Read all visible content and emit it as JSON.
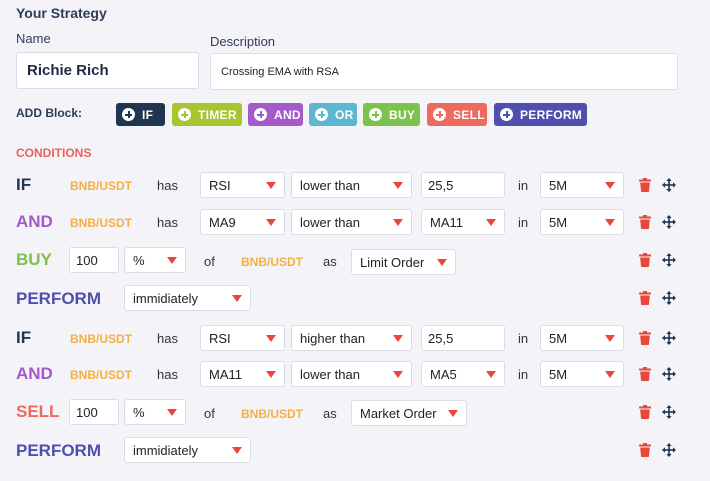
{
  "strategy": {
    "title": "Your Strategy",
    "name_label": "Name",
    "name_value": "Richie Rich",
    "description_label": "Description",
    "description_value": "Crossing EMA with RSA"
  },
  "add_block": {
    "label": "ADD Block:",
    "buttons": [
      {
        "label": "IF",
        "color": "#1f3550"
      },
      {
        "label": "TIMER",
        "color": "#a6c52f"
      },
      {
        "label": "AND",
        "color": "#a45ac8"
      },
      {
        "label": "OR",
        "color": "#5bb8d0"
      },
      {
        "label": "BUY",
        "color": "#7cc24b"
      },
      {
        "label": "SELL",
        "color": "#ee6a5e"
      },
      {
        "label": "PERFORM",
        "color": "#4f4fb0"
      }
    ]
  },
  "conditions": {
    "title": "CONDITIONS",
    "rows": [
      {
        "keyword": "IF",
        "pair": "BNB/USDT",
        "has": "has",
        "indicator": "RSI",
        "comparator": "lower than",
        "value": "25,5",
        "in": "in",
        "timeframe": "5M"
      },
      {
        "keyword": "AND",
        "pair": "BNB/USDT",
        "has": "has",
        "indicator": "MA9",
        "comparator": "lower than",
        "value": "MA11",
        "in": "in",
        "timeframe": "5M"
      },
      {
        "keyword": "BUY",
        "amount": "100",
        "unit": "%",
        "of": "of",
        "pair": "BNB/USDT",
        "as": "as",
        "order_type": "Limit Order"
      },
      {
        "keyword": "PERFORM",
        "timing": "immidiately"
      },
      {
        "keyword": "IF",
        "pair": "BNB/USDT",
        "has": "has",
        "indicator": "RSI",
        "comparator": "higher than",
        "value": "25,5",
        "in": "in",
        "timeframe": "5M"
      },
      {
        "keyword": "AND",
        "pair": "BNB/USDT",
        "has": "has",
        "indicator": "MA11",
        "comparator": "lower than",
        "value": "MA5",
        "in": "in",
        "timeframe": "5M"
      },
      {
        "keyword": "SELL",
        "amount": "100",
        "unit": "%",
        "of": "of",
        "pair": "BNB/USDT",
        "as": "as",
        "order_type": "Market Order"
      },
      {
        "keyword": "PERFORM",
        "timing": "immidiately"
      }
    ]
  },
  "colors": {
    "if": "#1f3550",
    "and": "#a45ac8",
    "buy": "#7cc24b",
    "sell": "#ee6a5e",
    "perform": "#4f4fb0",
    "pair": "#f5b043",
    "accent_red": "#e8473c",
    "move_icon": "#1f3550"
  },
  "icons": {
    "delete": "trash-icon",
    "move": "move-arrows-icon",
    "dropdown": "caret-down-icon",
    "add": "plus-circle-icon"
  }
}
